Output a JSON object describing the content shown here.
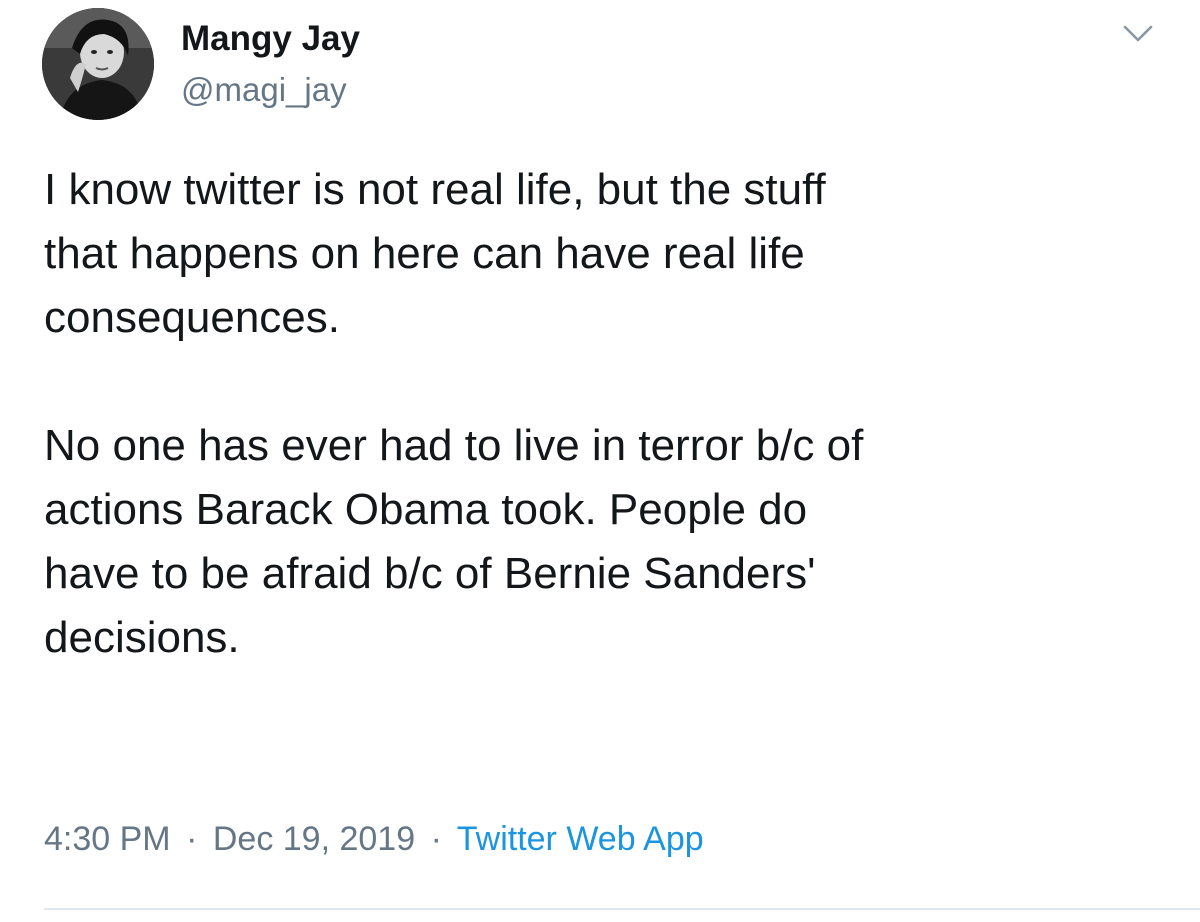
{
  "user": {
    "display_name": "Mangy Jay",
    "handle": "@magi_jay",
    "avatar_icon": "profile-photo"
  },
  "menu": {
    "icon": "chevron-down-icon"
  },
  "tweet": {
    "paragraph1_lines": [
      "I know twitter is not real life, but the stuff",
      "that happens on here can have real life",
      "consequences."
    ],
    "paragraph2_lines": [
      "No one has ever had to live in terror b/c of",
      "actions Barack Obama took. People do",
      "have to be afraid b/c of Bernie Sanders'",
      "decisions."
    ]
  },
  "meta": {
    "time": "4:30 PM",
    "separator": "·",
    "date": "Dec 19, 2019",
    "source": "Twitter Web App"
  },
  "colors": {
    "text": "#14171a",
    "secondary": "#657786",
    "link": "#1b95e0",
    "divider": "#e1e8ed"
  }
}
